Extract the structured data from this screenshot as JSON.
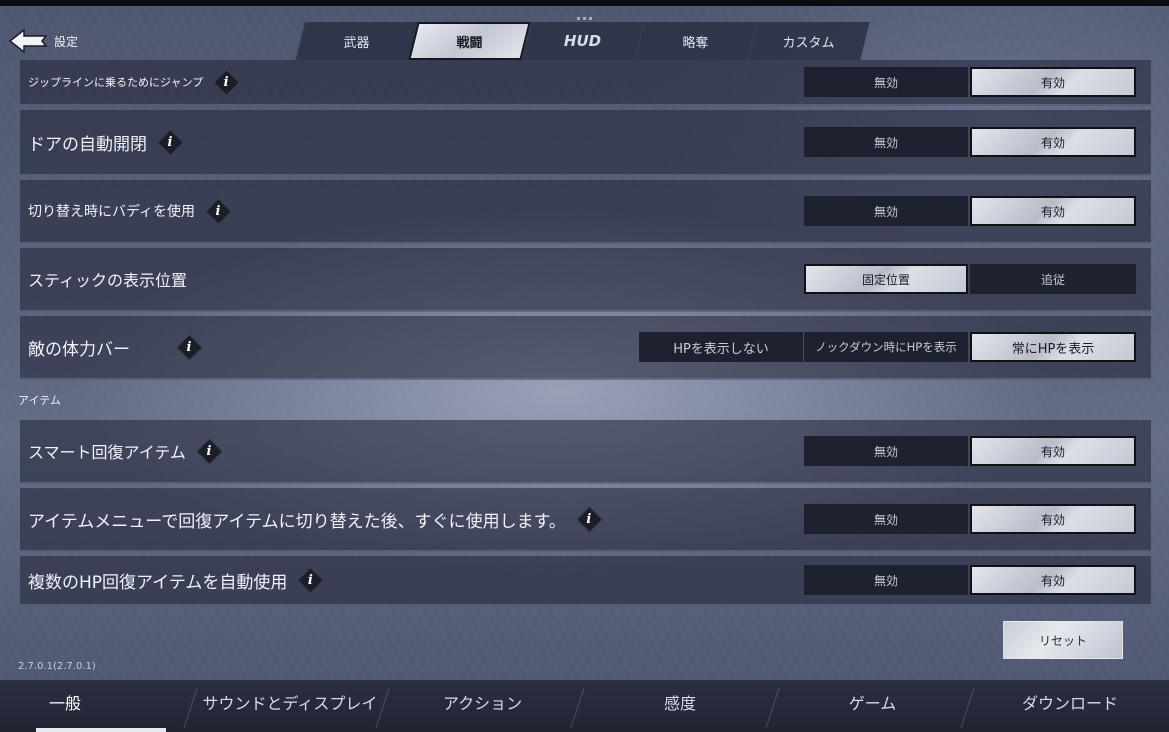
{
  "header": {
    "back_label": "設定",
    "tabs": [
      {
        "label": "武器"
      },
      {
        "label": "戦闘"
      },
      {
        "label": "HUD"
      },
      {
        "label": "略奪"
      },
      {
        "label": "カスタム"
      }
    ],
    "active_tab": "戦闘"
  },
  "rows": [
    {
      "label": "ジップラインに乗るためにジャンプ",
      "info": true,
      "options": [
        "無効",
        "有効"
      ],
      "selected": "有効"
    },
    {
      "label": "ドアの自動開閉",
      "info": true,
      "options": [
        "無効",
        "有効"
      ],
      "selected": "有効"
    },
    {
      "label": "切り替え時にバディを使用",
      "info": true,
      "options": [
        "無効",
        "有効"
      ],
      "selected": "有効"
    },
    {
      "label": "スティックの表示位置",
      "info": false,
      "options": [
        "固定位置",
        "追従"
      ],
      "selected": "固定位置"
    },
    {
      "label": "敵の体力バー",
      "info": true,
      "options": [
        "HPを表示しない",
        "ノックダウン時にHPを表示",
        "常にHPを表示"
      ],
      "selected": "常にHPを表示"
    }
  ],
  "section_items": {
    "title": "アイテム",
    "rows": [
      {
        "label": "スマート回復アイテム",
        "info": true,
        "options": [
          "無効",
          "有効"
        ],
        "selected": "有効"
      },
      {
        "label": "アイテムメニューで回復アイテムに切り替えた後、すぐに使用します。",
        "info": true,
        "options": [
          "無効",
          "有効"
        ],
        "selected": "有効"
      },
      {
        "label": "複数のHP回復アイテムを自動使用",
        "info": true,
        "options": [
          "無効",
          "有効"
        ],
        "selected": "有効"
      }
    ]
  },
  "reset_label": "リセット",
  "version": "2.7.0.1(2.7.0.1)",
  "bottom_tabs": [
    {
      "label": "一般"
    },
    {
      "label": "サウンドとディスプレイ"
    },
    {
      "label": "アクション"
    },
    {
      "label": "感度"
    },
    {
      "label": "ゲーム"
    },
    {
      "label": "ダウンロード"
    }
  ],
  "bottom_active": "一般",
  "info_glyph": "i"
}
